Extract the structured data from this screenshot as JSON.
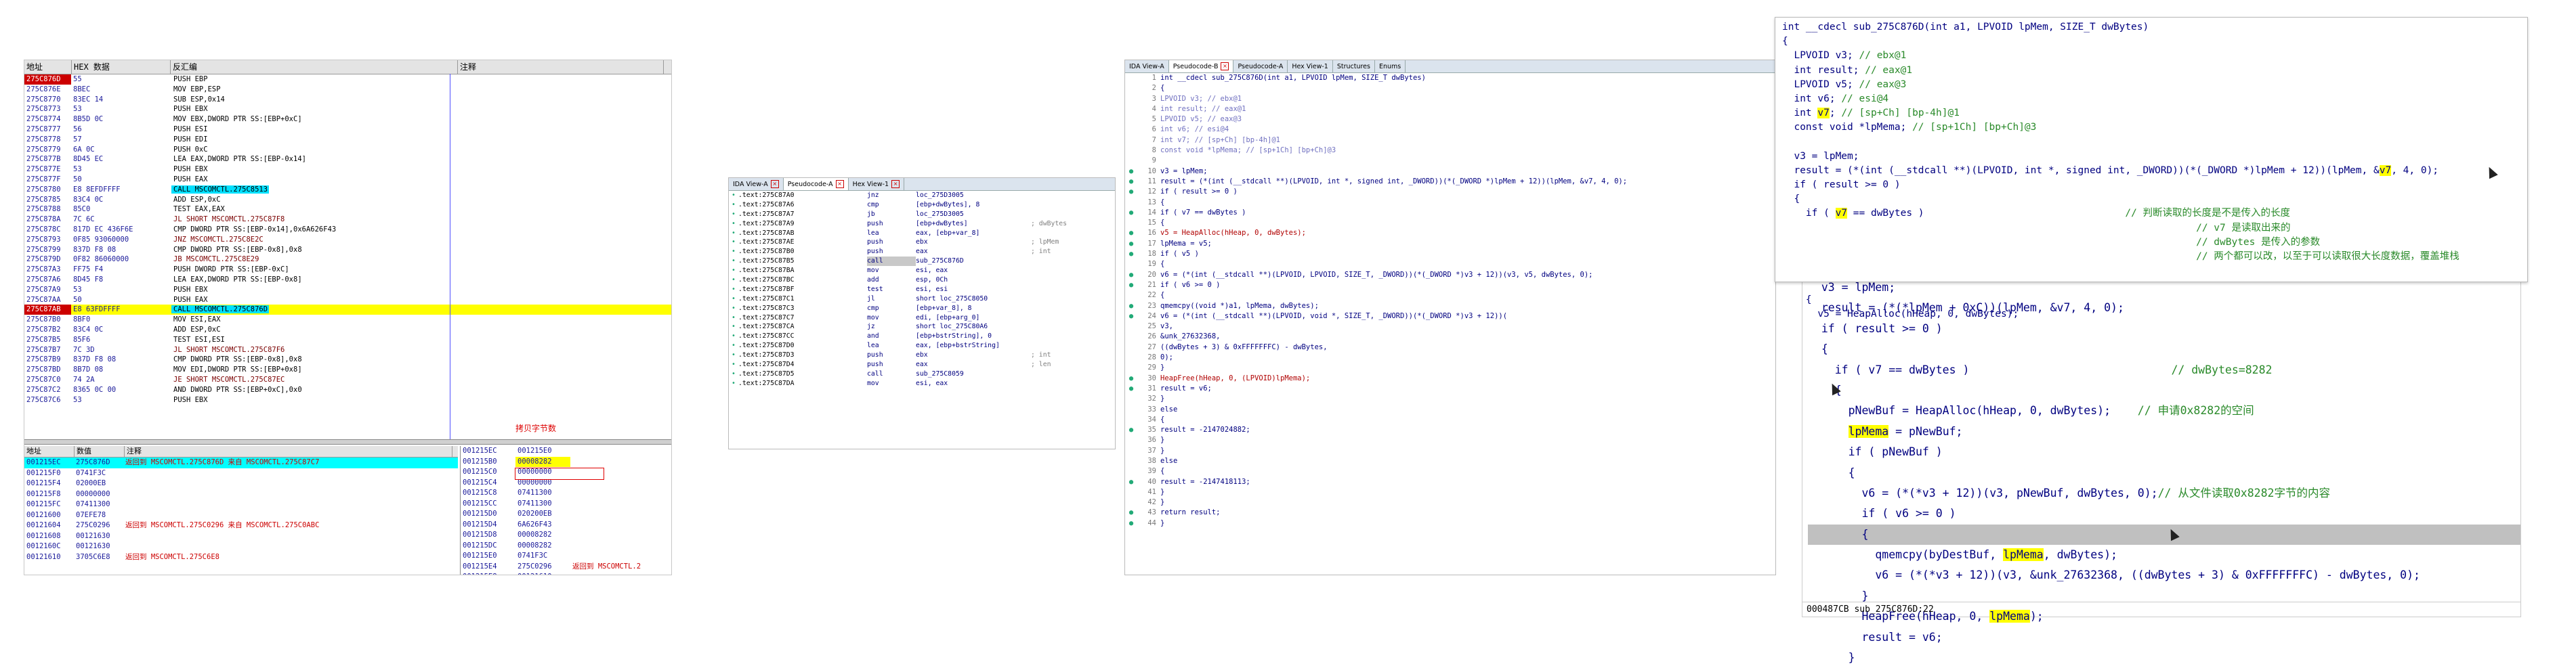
{
  "olly": {
    "headers": [
      "地址",
      "HEX 数据",
      "反汇编",
      "注释"
    ],
    "rows": [
      {
        "addr": "275C876D",
        "hex": "55",
        "dis": "PUSH EBP",
        "cmt": "",
        "kind": "first"
      },
      {
        "addr": "275C876E",
        "hex": "8BEC",
        "dis": "MOV EBP,ESP",
        "cmt": ""
      },
      {
        "addr": "275C8770",
        "hex": "83EC 14",
        "dis": "SUB ESP,0x14",
        "cmt": ""
      },
      {
        "addr": "275C8773",
        "hex": "53",
        "dis": "PUSH EBX",
        "cmt": ""
      },
      {
        "addr": "275C8774",
        "hex": "8B5D 0C",
        "dis": "MOV EBX,DWORD PTR SS:[EBP+0xC]",
        "cmt": ""
      },
      {
        "addr": "275C8777",
        "hex": "56",
        "dis": "PUSH ESI",
        "cmt": ""
      },
      {
        "addr": "275C8778",
        "hex": "57",
        "dis": "PUSH EDI",
        "cmt": ""
      },
      {
        "addr": "275C8779",
        "hex": "6A 0C",
        "dis": "PUSH 0xC",
        "cmt": ""
      },
      {
        "addr": "275C877B",
        "hex": "8D45 EC",
        "dis": "LEA EAX,DWORD PTR SS:[EBP-0x14]",
        "cmt": ""
      },
      {
        "addr": "275C877E",
        "hex": "53",
        "dis": "PUSH EBX",
        "cmt": ""
      },
      {
        "addr": "275C877F",
        "hex": "50",
        "dis": "PUSH EAX",
        "cmt": ""
      },
      {
        "addr": "275C8780",
        "hex": "E8 8EFDFFFF",
        "dis": "CALL MSCOMCTL.275C8513",
        "cmt": "",
        "call": true
      },
      {
        "addr": "275C8785",
        "hex": "83C4 0C",
        "dis": "ADD ESP,0xC",
        "cmt": ""
      },
      {
        "addr": "275C8788",
        "hex": "85C0",
        "dis": "TEST EAX,EAX",
        "cmt": ""
      },
      {
        "addr": "275C878A",
        "hex": "7C 6C",
        "dis": "JL SHORT MSCOMCTL.275C87F8",
        "cmt": "",
        "kind": "jmp"
      },
      {
        "addr": "275C878C",
        "hex": "817D EC 436F6E",
        "dis": "CMP DWORD PTR SS:[EBP-0x14],0x6A626F43",
        "cmt": ""
      },
      {
        "addr": "275C8793",
        "hex": "0F85 93060000",
        "dis": "JNZ MSCOMCTL.275C8E2C",
        "cmt": "",
        "kind": "jmp"
      },
      {
        "addr": "275C8799",
        "hex": "837D F8 08",
        "dis": "CMP DWORD PTR SS:[EBP-0x8],0x8",
        "cmt": ""
      },
      {
        "addr": "275C879D",
        "hex": "0F82 86060000",
        "dis": "JB MSCOMCTL.275C8E29",
        "cmt": "",
        "kind": "jmp"
      },
      {
        "addr": "275C87A3",
        "hex": "FF75 F4",
        "dis": "PUSH DWORD PTR SS:[EBP-0xC]",
        "cmt": ""
      },
      {
        "addr": "275C87A6",
        "hex": "8D45 F8",
        "dis": "LEA EAX,DWORD PTR SS:[EBP-0x8]",
        "cmt": ""
      },
      {
        "addr": "275C87A9",
        "hex": "53",
        "dis": "PUSH EBX",
        "cmt": ""
      },
      {
        "addr": "275C87AA",
        "hex": "50",
        "dis": "PUSH EAX",
        "cmt": ""
      },
      {
        "addr": "275C87AB",
        "hex": "E8 63FDFFFF",
        "dis": "CALL MSCOMCTL.275C876D",
        "cmt": "",
        "kind": "sel",
        "call": true
      },
      {
        "addr": "275C87B0",
        "hex": "8BF0",
        "dis": "MOV ESI,EAX",
        "cmt": ""
      },
      {
        "addr": "275C87B2",
        "hex": "83C4 0C",
        "dis": "ADD ESP,0xC",
        "cmt": ""
      },
      {
        "addr": "275C87B5",
        "hex": "85F6",
        "dis": "TEST ESI,ESI",
        "cmt": ""
      },
      {
        "addr": "275C87B7",
        "hex": "7C 3D",
        "dis": "JL SHORT MSCOMCTL.275C87F6",
        "cmt": "",
        "kind": "jmp"
      },
      {
        "addr": "275C87B9",
        "hex": "837D F8 08",
        "dis": "CMP DWORD PTR SS:[EBP-0x8],0x8",
        "cmt": ""
      },
      {
        "addr": "275C87BD",
        "hex": "8B7D 08",
        "dis": "MOV EDI,DWORD PTR SS:[EBP+0x8]",
        "cmt": ""
      },
      {
        "addr": "275C87C0",
        "hex": "74 2A",
        "dis": "JE SHORT MSCOMCTL.275C87EC",
        "cmt": "",
        "kind": "jmp"
      },
      {
        "addr": "275C87C2",
        "hex": "8365 0C 00",
        "dis": "AND DWORD PTR SS:[EBP+0xC],0x0",
        "cmt": ""
      },
      {
        "addr": "275C87C6",
        "hex": "53",
        "dis": "PUSH EBX",
        "cmt": ""
      }
    ],
    "note": "拷贝字节数",
    "dump_headers": [
      "地址",
      "数值",
      "注释"
    ],
    "dump_rows": [
      {
        "a": "001215EC",
        "v": "275C876D",
        "c": "返回到 MSCOMCTL.275C876D 来自 MSCOMCTL.275C87C7",
        "hl": true
      },
      {
        "a": "001215F0",
        "v": "0741F3C",
        "c": ""
      },
      {
        "a": "001215F4",
        "v": "02000EB",
        "c": ""
      },
      {
        "a": "001215F8",
        "v": "00000000",
        "c": ""
      },
      {
        "a": "001215FC",
        "v": "07411300",
        "c": ""
      },
      {
        "a": "00121600",
        "v": "07EFE78",
        "c": ""
      },
      {
        "a": "00121604",
        "v": "275C0296",
        "c": "返回到 MSCOMCTL.275C0296 来自 MSCOMCTL.275C0ABC"
      },
      {
        "a": "00121608",
        "v": "00121630",
        "c": ""
      },
      {
        "a": "0012160C",
        "v": "00121630",
        "c": ""
      },
      {
        "a": "00121610",
        "v": "3705C6E8",
        "c": "返回到 MSCOMCTL.275C6E8"
      }
    ],
    "stack_rows": [
      {
        "a": "001215EC",
        "v": "001215E0",
        "c": ""
      },
      {
        "a": "001215B0",
        "v": "00008282",
        "c": "",
        "hl": true
      },
      {
        "a": "001215C0",
        "v": "00000000",
        "c": ""
      },
      {
        "a": "001215C4",
        "v": "00000000",
        "c": ""
      },
      {
        "a": "001215C8",
        "v": "07411300",
        "c": ""
      },
      {
        "a": "001215CC",
        "v": "07411300",
        "c": ""
      },
      {
        "a": "001215D0",
        "v": "020200EB",
        "c": ""
      },
      {
        "a": "001215D4",
        "v": "6A626F43",
        "c": ""
      },
      {
        "a": "001215D8",
        "v": "00008282",
        "c": ""
      },
      {
        "a": "001215DC",
        "v": "00008282",
        "c": ""
      },
      {
        "a": "001215E0",
        "v": "0741F3C",
        "c": ""
      },
      {
        "a": "001215E4",
        "v": "275C0296",
        "c": "返回到 MSCOMCTL.2"
      },
      {
        "a": "001215E8",
        "v": "00121610",
        "c": ""
      }
    ]
  },
  "ida_small": {
    "tabs": [
      {
        "label": "IDA View-A",
        "close": true
      },
      {
        "label": "Pseudocode-A",
        "close": true
      },
      {
        "label": "Hex View-1",
        "close": true
      }
    ],
    "rows": [
      {
        "addr": ".text:275C87A0",
        "mn": "jnz",
        "op": "loc_275D3005",
        "cm": ""
      },
      {
        "addr": ".text:275C87A6",
        "mn": "cmp",
        "op": "[ebp+dwBytes], 8",
        "cm": ""
      },
      {
        "addr": ".text:275C87A7",
        "mn": "jb",
        "op": "loc_275D3005",
        "cm": ""
      },
      {
        "addr": ".text:275C87A9",
        "mn": "push",
        "op": "[ebp+dwBytes]",
        "cm": "; dwBytes"
      },
      {
        "addr": ".text:275C87AB",
        "mn": "lea",
        "op": "eax, [ebp+var_8]",
        "cm": ""
      },
      {
        "addr": ".text:275C87AE",
        "mn": "push",
        "op": "ebx",
        "cm": "; lpMem"
      },
      {
        "addr": ".text:275C87B0",
        "mn": "push",
        "op": "eax",
        "cm": "; int"
      },
      {
        "addr": ".text:275C87B5",
        "mn": "call",
        "op": "sub_275C876D",
        "cm": "",
        "hl": true
      },
      {
        "addr": ".text:275C87BA",
        "mn": "mov",
        "op": "esi, eax",
        "cm": ""
      },
      {
        "addr": ".text:275C87BC",
        "mn": "add",
        "op": "esp, 0Ch",
        "cm": ""
      },
      {
        "addr": ".text:275C87BF",
        "mn": "test",
        "op": "esi, esi",
        "cm": ""
      },
      {
        "addr": ".text:275C87C1",
        "mn": "jl",
        "op": "short loc_275C8050",
        "cm": ""
      },
      {
        "addr": ".text:275C87C3",
        "mn": "cmp",
        "op": "[ebp+var_8], 8",
        "cm": ""
      },
      {
        "addr": ".text:275C87C7",
        "mn": "mov",
        "op": "edi, [ebp+arg_0]",
        "cm": ""
      },
      {
        "addr": ".text:275C87CA",
        "mn": "jz",
        "op": "short loc_275C80A6",
        "cm": ""
      },
      {
        "addr": ".text:275C87CC",
        "mn": "and",
        "op": "[ebp+bstrString], 0",
        "cm": ""
      },
      {
        "addr": ".text:275C87D0",
        "mn": "lea",
        "op": "eax, [ebp+bstrString]",
        "cm": ""
      },
      {
        "addr": ".text:275C87D3",
        "mn": "push",
        "op": "ebx",
        "cm": "; int"
      },
      {
        "addr": ".text:275C87D4",
        "mn": "push",
        "op": "eax",
        "cm": "; len"
      },
      {
        "addr": ".text:275C87D5",
        "mn": "call",
        "op": "sub_275C8059",
        "cm": ""
      },
      {
        "addr": ".text:275C87DA",
        "mn": "mov",
        "op": "esi, eax",
        "cm": ""
      }
    ]
  },
  "ida_pseudo": {
    "tabs": [
      {
        "label": "IDA View-A",
        "close": false
      },
      {
        "label": "Pseudocode-B",
        "close": true
      },
      {
        "label": "Pseudocode-A",
        "close": false
      },
      {
        "label": "Hex View-1",
        "close": false
      },
      {
        "label": "Structures",
        "close": false
      },
      {
        "label": "Enums",
        "close": false
      }
    ],
    "lines": [
      {
        "n": "1",
        "c": "int __cdecl sub_275C876D(int a1, LPVOID lpMem, SIZE_T dwBytes)",
        "dot": false
      },
      {
        "n": "2",
        "c": "{",
        "dot": false
      },
      {
        "n": "3",
        "c": "  LPVOID v3; // ebx@1",
        "dot": false,
        "cm": true
      },
      {
        "n": "4",
        "c": "  int result; // eax@1",
        "dot": false,
        "cm": true
      },
      {
        "n": "5",
        "c": "  LPVOID v5; // eax@3",
        "dot": false,
        "cm": true
      },
      {
        "n": "6",
        "c": "  int v6; // esi@4",
        "dot": false,
        "cm": true
      },
      {
        "n": "7",
        "c": "  int v7; // [sp+Ch] [bp-4h]@1",
        "dot": false,
        "cm": true
      },
      {
        "n": "8",
        "c": "  const void *lpMema; // [sp+1Ch] [bp+Ch]@3",
        "dot": false,
        "cm": true
      },
      {
        "n": "9",
        "c": "",
        "dot": false
      },
      {
        "n": "10",
        "c": "  v3 = lpMem;",
        "dot": true
      },
      {
        "n": "11",
        "c": "  result = (*(int (__stdcall **)(LPVOID, int *, signed int, _DWORD))(*(_DWORD *)lpMem + 12))(lpMem, &v7, 4, 0);",
        "dot": true
      },
      {
        "n": "12",
        "c": "  if ( result >= 0 )",
        "dot": true
      },
      {
        "n": "13",
        "c": "  {",
        "dot": false
      },
      {
        "n": "14",
        "c": "    if ( v7 == dwBytes )",
        "dot": true
      },
      {
        "n": "15",
        "c": "    {",
        "dot": false
      },
      {
        "n": "16",
        "c": "      v5 = HeapAlloc(hHeap, 0, dwBytes);",
        "dot": true,
        "red": true
      },
      {
        "n": "17",
        "c": "      lpMema = v5;",
        "dot": true
      },
      {
        "n": "18",
        "c": "      if ( v5 )",
        "dot": true
      },
      {
        "n": "19",
        "c": "      {",
        "dot": false
      },
      {
        "n": "20",
        "c": "        v6 = (*(int (__stdcall **)(LPVOID, LPVOID, SIZE_T, _DWORD))(*(_DWORD *)v3 + 12))(v3, v5, dwBytes, 0);",
        "dot": true
      },
      {
        "n": "21",
        "c": "        if ( v6 >= 0 )",
        "dot": true
      },
      {
        "n": "22",
        "c": "        {",
        "dot": false
      },
      {
        "n": "23",
        "c": "          qmemcpy((void *)a1, lpMema, dwBytes);",
        "dot": true
      },
      {
        "n": "24",
        "c": "          v6 = (*(int (__stdcall **)(LPVOID, void *, SIZE_T, _DWORD))(*(_DWORD *)v3 + 12))(",
        "dot": true
      },
      {
        "n": "25",
        "c": "                 v3,",
        "dot": false
      },
      {
        "n": "26",
        "c": "                 &unk_27632368,",
        "dot": false
      },
      {
        "n": "27",
        "c": "                 ((dwBytes + 3) & 0xFFFFFFFC) - dwBytes,",
        "dot": false
      },
      {
        "n": "28",
        "c": "                 0);",
        "dot": false
      },
      {
        "n": "29",
        "c": "        }",
        "dot": false
      },
      {
        "n": "30",
        "c": "        HeapFree(hHeap, 0, (LPVOID)lpMema);",
        "dot": true,
        "red": true
      },
      {
        "n": "31",
        "c": "        result = v6;",
        "dot": true
      },
      {
        "n": "32",
        "c": "      }",
        "dot": false
      },
      {
        "n": "33",
        "c": "      else",
        "dot": false
      },
      {
        "n": "34",
        "c": "      {",
        "dot": false
      },
      {
        "n": "35",
        "c": "        result = -2147024882;",
        "dot": true
      },
      {
        "n": "36",
        "c": "      }",
        "dot": false
      },
      {
        "n": "37",
        "c": "    }",
        "dot": false
      },
      {
        "n": "38",
        "c": "    else",
        "dot": false
      },
      {
        "n": "39",
        "c": "    {",
        "dot": false
      },
      {
        "n": "40",
        "c": "      result = -2147418113;",
        "dot": true
      },
      {
        "n": "41",
        "c": "    }",
        "dot": false
      },
      {
        "n": "42",
        "c": "  }",
        "dot": false
      },
      {
        "n": "43",
        "c": "  return result;",
        "dot": true
      },
      {
        "n": "44",
        "c": "}",
        "dot": true
      }
    ]
  },
  "right_top": {
    "lines": [
      {
        "pre": "int __cdecl sub_275C876D(int a1, LPVOID lpMem, SIZE_T dwBytes)",
        "hl": "",
        "post": "",
        "cm": "",
        "plain": true
      },
      {
        "pre": "{",
        "hl": "",
        "post": "",
        "cm": ""
      },
      {
        "pre": "  LPVOID v3; ",
        "hl": "",
        "post": "",
        "cm": "// ebx@1"
      },
      {
        "pre": "  int result; ",
        "hl": "",
        "post": "",
        "cm": "// eax@1"
      },
      {
        "pre": "  LPVOID v5; ",
        "hl": "",
        "post": "",
        "cm": "// eax@3"
      },
      {
        "pre": "  int v6; ",
        "hl": "",
        "post": "",
        "cm": "// esi@4"
      },
      {
        "pre": "  int ",
        "hl": "v7",
        "post": "; ",
        "cm": "// [sp+Ch] [bp-4h]@1"
      },
      {
        "pre": "  const void *lpMema; ",
        "hl": "",
        "post": "",
        "cm": "// [sp+1Ch] [bp+Ch]@3"
      },
      {
        "pre": "",
        "hl": "",
        "post": "",
        "cm": ""
      },
      {
        "pre": "  v3 = lpMem;",
        "hl": "",
        "post": "",
        "cm": ""
      },
      {
        "pre": "  result = (*(int (__stdcall **)(LPVOID, int *, signed int, _DWORD))(*(_DWORD *)lpMem + 12))(lpMem, &",
        "hl": "v7",
        "post": ", 4, 0);",
        "cm": ""
      },
      {
        "pre": "  if ( result >= 0 )",
        "hl": "",
        "post": "",
        "cm": ""
      },
      {
        "pre": "  {",
        "hl": "",
        "post": "",
        "cm": ""
      },
      {
        "pre": "    if ( ",
        "hl": "v7",
        "post": " == dwBytes )                                  ",
        "cm": "// 判断读取的长度是不是传入的长度"
      },
      {
        "pre": "                                                                      ",
        "hl": "",
        "post": "",
        "cm": "// v7 是读取出来的"
      },
      {
        "pre": "                                                                      ",
        "hl": "",
        "post": "",
        "cm": "// dwBytes 是传入的参数"
      },
      {
        "pre": "                                                                      ",
        "hl": "",
        "post": "",
        "cm": "// 两个都可以改，以至于可以读取很大长度数据，覆盖堆栈"
      },
      {
        "pre": "",
        "hl": "",
        "post": "",
        "cm": ""
      },
      {
        "pre": "",
        "hl": "",
        "post": "",
        "cm": ""
      },
      {
        "pre": "    {",
        "hl": "",
        "post": "",
        "cm": ""
      },
      {
        "pre": "      v5 = HeapAlloc(hHeap, 0, dwBytes);",
        "hl": "",
        "post": "",
        "cm": ""
      }
    ]
  },
  "right_bottom": {
    "lines": [
      {
        "pre": "  v3 = lpMem;",
        "hl": "",
        "post": "",
        "cm": ""
      },
      {
        "pre": "  result = (*(*lpMem + 0xC))(lpMem, &v7, 4, 0);",
        "hl": "",
        "post": "",
        "cm": ""
      },
      {
        "pre": "  if ( result >= 0 )",
        "hl": "",
        "post": "",
        "cm": ""
      },
      {
        "pre": "  {",
        "hl": "",
        "post": "",
        "cm": ""
      },
      {
        "pre": "    if ( v7 == dwBytes )                              ",
        "hl": "",
        "post": "",
        "cm": "// dwBytes=8282"
      },
      {
        "pre": "    {",
        "hl": "",
        "post": "",
        "cm": ""
      },
      {
        "pre": "      pNewBuf = HeapAlloc(hHeap, 0, dwBytes);    ",
        "hl": "",
        "post": "",
        "cm": "// 申请0x8282的空间"
      },
      {
        "pre": "      ",
        "hl": "lpMema",
        "post": " = pNewBuf;",
        "cm": ""
      },
      {
        "pre": "      if ( pNewBuf )",
        "hl": "",
        "post": "",
        "cm": ""
      },
      {
        "pre": "      {",
        "hl": "",
        "post": "",
        "cm": ""
      },
      {
        "pre": "        v6 = (*(*v3 + 12))(v3, pNewBuf, dwBytes, 0);",
        "hl": "",
        "post": "",
        "cm": "// 从文件读取0x8282字节的内容"
      },
      {
        "pre": "        if ( v6 >= 0 )",
        "hl": "",
        "post": "",
        "cm": ""
      },
      {
        "pre": "        {",
        "hl": "",
        "post": "",
        "cm": "",
        "row": true
      },
      {
        "pre": "          qmemcpy(byDestBuf, ",
        "hl": "lpMema",
        "post": ", dwBytes);",
        "cm": ""
      },
      {
        "pre": "          v6 = (*(*v3 + 12))(v3, &unk_27632368, ((dwBytes + 3) & 0xFFFFFFFC) - dwBytes, 0);",
        "hl": "",
        "post": "",
        "cm": ""
      },
      {
        "pre": "        }",
        "hl": "",
        "post": "",
        "cm": ""
      },
      {
        "pre": "        HeapFree(hHeap, 0, ",
        "hl": "lpMema",
        "post": ");",
        "cm": ""
      },
      {
        "pre": "        result = v6;",
        "hl": "",
        "post": "",
        "cm": ""
      },
      {
        "pre": "      }",
        "hl": "",
        "post": "",
        "cm": ""
      }
    ],
    "status": "000487CB sub_275C876D:22"
  }
}
